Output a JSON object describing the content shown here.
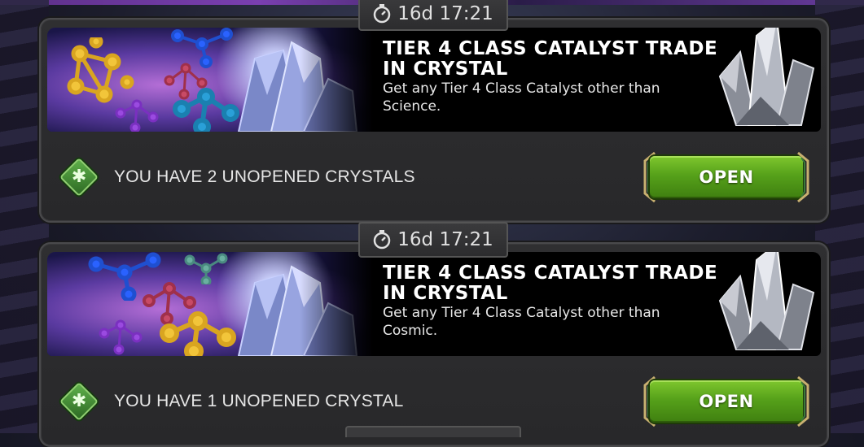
{
  "offers": [
    {
      "timer": "16d 17:21",
      "title_line1": "TIER 4 CLASS CATALYST TRADE",
      "title_line2": "IN CRYSTAL",
      "desc_line1": "Get any Tier 4 Class Catalyst other than",
      "desc_line2": "Science.",
      "status": "YOU HAVE 2 UNOPENED CRYSTALS",
      "button": "OPEN"
    },
    {
      "timer": "16d 17:21",
      "title_line1": "TIER 4 CLASS CATALYST TRADE",
      "title_line2": "IN CRYSTAL",
      "desc_line1": "Get any Tier 4 Class Catalyst other than",
      "desc_line2": "Cosmic.",
      "status": "YOU HAVE 1 UNOPENED CRYSTAL",
      "button": "OPEN"
    }
  ],
  "icons": {
    "timer": "stopwatch-icon",
    "status": "green-gem-icon",
    "crystal": "crystal-icon"
  },
  "colors": {
    "open_button": "#56a11a",
    "gem": "#4a9a38",
    "panel": "#2d2d2f"
  }
}
